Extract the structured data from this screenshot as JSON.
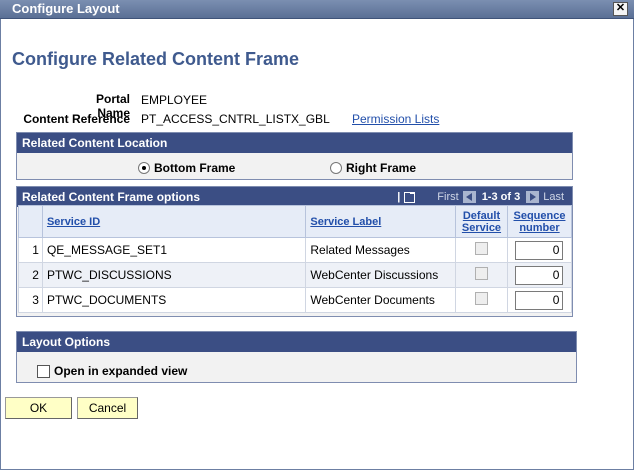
{
  "window": {
    "title": "Configure Layout",
    "close_glyph": "✕"
  },
  "page": {
    "title": "Configure Related Content Frame"
  },
  "fields": {
    "portal_name_label": "Portal Name",
    "portal_name_value": "EMPLOYEE",
    "content_reference_label": "Content Reference",
    "content_reference_value": "PT_ACCESS_CNTRL_LISTX_GBL",
    "permission_lists_link": "Permission Lists"
  },
  "location": {
    "header": "Related Content Location",
    "options": [
      {
        "label": "Bottom Frame",
        "selected": true
      },
      {
        "label": "Right Frame",
        "selected": false
      }
    ]
  },
  "options_grid": {
    "header": "Related Content Frame options",
    "nav": {
      "first": "First",
      "count": "1-3 of 3",
      "last": "Last"
    },
    "columns": {
      "service_id": "Service ID",
      "service_label": "Service Label",
      "default_service": "Default Service",
      "sequence_number": "Sequence number"
    },
    "rows": [
      {
        "num": "1",
        "service_id": "QE_MESSAGE_SET1",
        "service_label": "Related Messages",
        "default": false,
        "sequence": "0"
      },
      {
        "num": "2",
        "service_id": "PTWC_DISCUSSIONS",
        "service_label": "WebCenter Discussions",
        "default": false,
        "sequence": "0"
      },
      {
        "num": "3",
        "service_id": "PTWC_DOCUMENTS",
        "service_label": "WebCenter Documents",
        "default": false,
        "sequence": "0"
      }
    ]
  },
  "layout": {
    "header": "Layout Options",
    "expanded_label": "Open in expanded view"
  },
  "buttons": {
    "ok": "OK",
    "cancel": "Cancel"
  },
  "colors": {
    "group_header": "#3b4e84",
    "title": "#3f5a8e",
    "link": "#224faa",
    "button": "#ffffc6"
  }
}
